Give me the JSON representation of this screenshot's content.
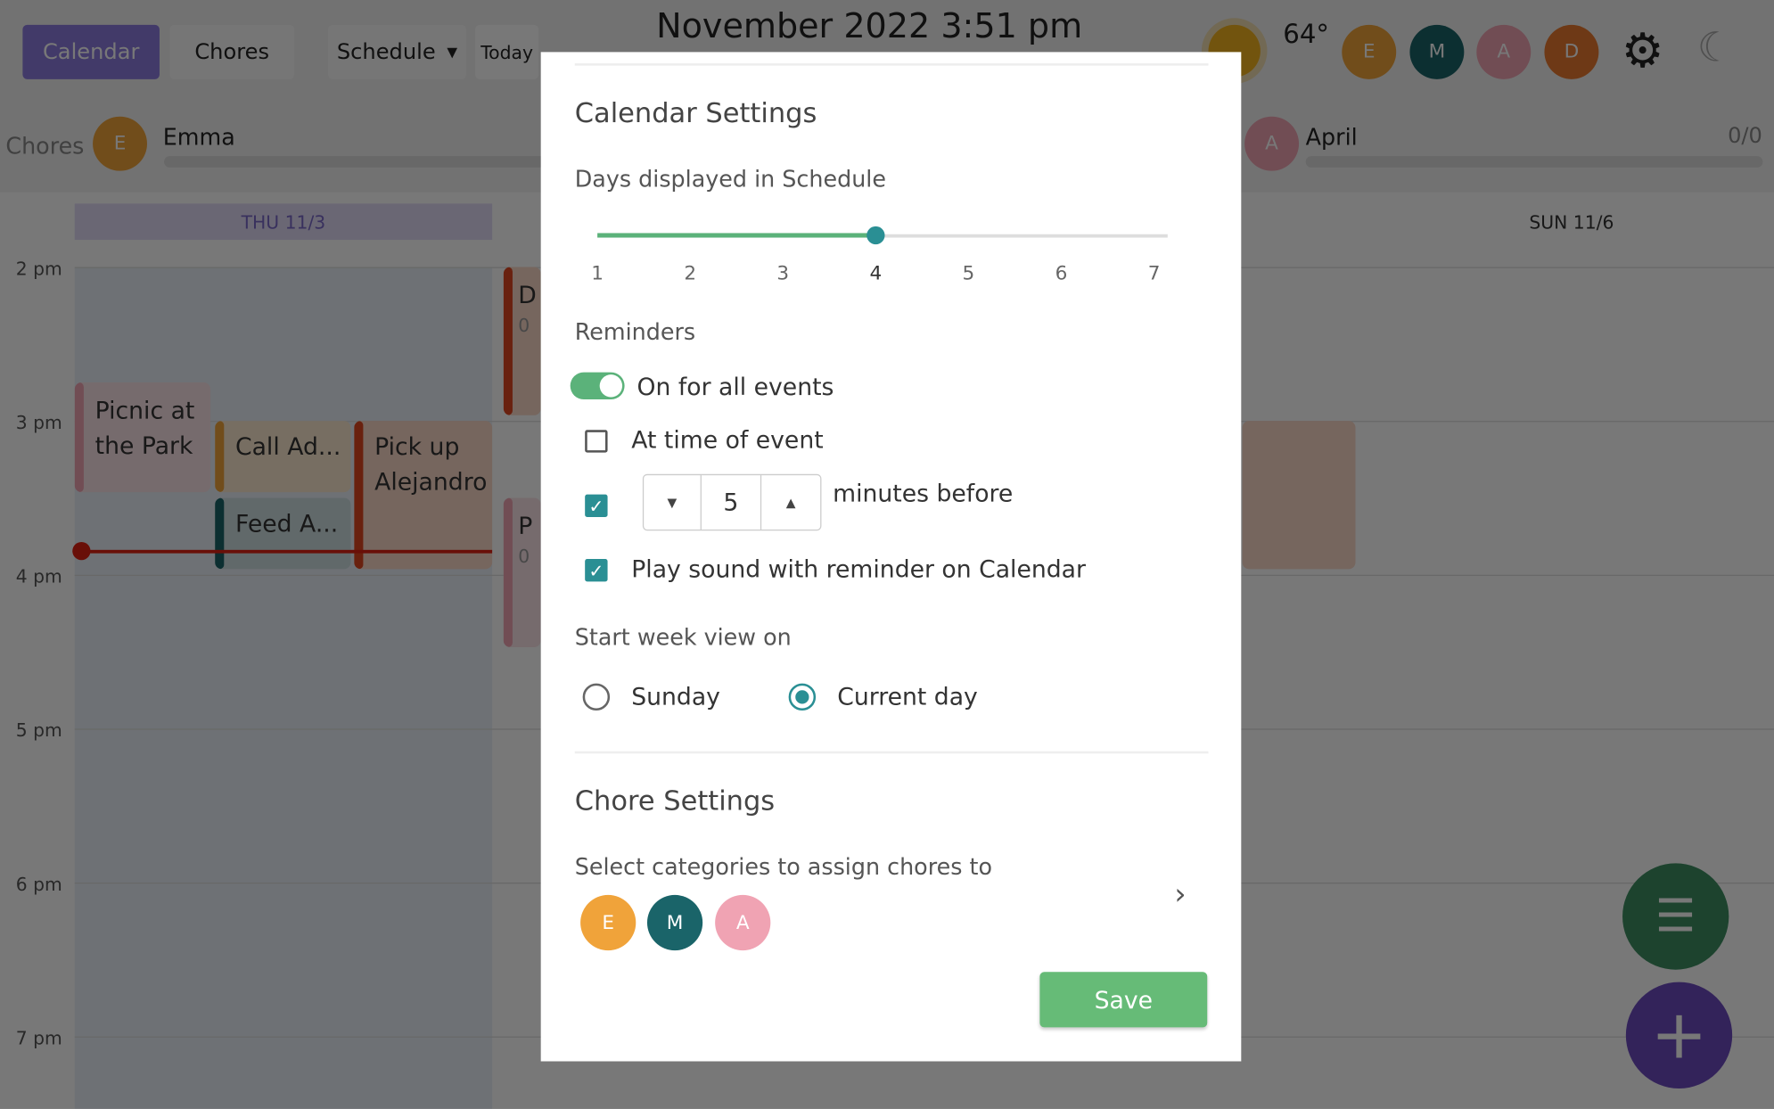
{
  "topbar": {
    "calendar_tab": "Calendar",
    "chores_tab": "Chores",
    "view_select": "Schedule",
    "today_button": "Today",
    "title": "November 2022 3:51 pm",
    "temperature": "64°",
    "weather_icon": "sun-icon"
  },
  "family": [
    {
      "initial": "E",
      "color": "#f0a33a"
    },
    {
      "initial": "M",
      "color": "#1a6469"
    },
    {
      "initial": "A",
      "color": "#f0a3b3"
    },
    {
      "initial": "D",
      "color": "#e97a2f"
    }
  ],
  "chores_bar": {
    "label": "Chores",
    "left_person": {
      "initial": "E",
      "name": "Emma"
    },
    "right_person": {
      "initial": "A",
      "name": "April",
      "count": "0/0"
    }
  },
  "days": {
    "first": "THU 11/3",
    "last": "SUN 11/6"
  },
  "times": [
    "2 pm",
    "3 pm",
    "4 pm",
    "5 pm",
    "6 pm",
    "7 pm"
  ],
  "events": [
    {
      "title": "Picnic at the Park",
      "color": "#f0a3b3"
    },
    {
      "title": "Call Ad...",
      "color": "#f0a33a"
    },
    {
      "title": "Feed A...",
      "color": "#1a6469"
    },
    {
      "title": "Pick up Alejandro",
      "color": "#e0461f"
    },
    {
      "title": "D",
      "sub": "0",
      "color": "#e0461f"
    },
    {
      "title": "P",
      "sub": "0",
      "color": "#f0a3b3"
    }
  ],
  "modal": {
    "calendar_settings_title": "Calendar Settings",
    "days_label": "Days displayed in Schedule",
    "days_ticks": [
      "1",
      "2",
      "3",
      "4",
      "5",
      "6",
      "7"
    ],
    "days_value": 4,
    "reminders_title": "Reminders",
    "reminders_toggle": {
      "label": "On for all events",
      "on": true
    },
    "at_time_of_event": {
      "label": "At time of event",
      "checked": false
    },
    "minutes_before": {
      "value": "5",
      "label": "minutes before",
      "checked": true
    },
    "play_sound": {
      "label": "Play sound with reminder on Calendar",
      "checked": true
    },
    "start_week_label": "Start week view on",
    "start_week_options": [
      {
        "label": "Sunday",
        "selected": false
      },
      {
        "label": "Current day",
        "selected": true
      }
    ],
    "chore_settings_title": "Chore Settings",
    "categories_label": "Select categories to assign chores to",
    "categories": [
      {
        "initial": "E",
        "color": "#f0a33a"
      },
      {
        "initial": "M",
        "color": "#1a6469"
      },
      {
        "initial": "A",
        "color": "#f0a3b3"
      }
    ],
    "save_label": "Save"
  },
  "colors": {
    "accent": "#2a8f94",
    "save": "#66bb77",
    "calendar_tab": "#8d7be0",
    "fab_list": "#3d8f62",
    "fab_add": "#6d4bc0"
  }
}
